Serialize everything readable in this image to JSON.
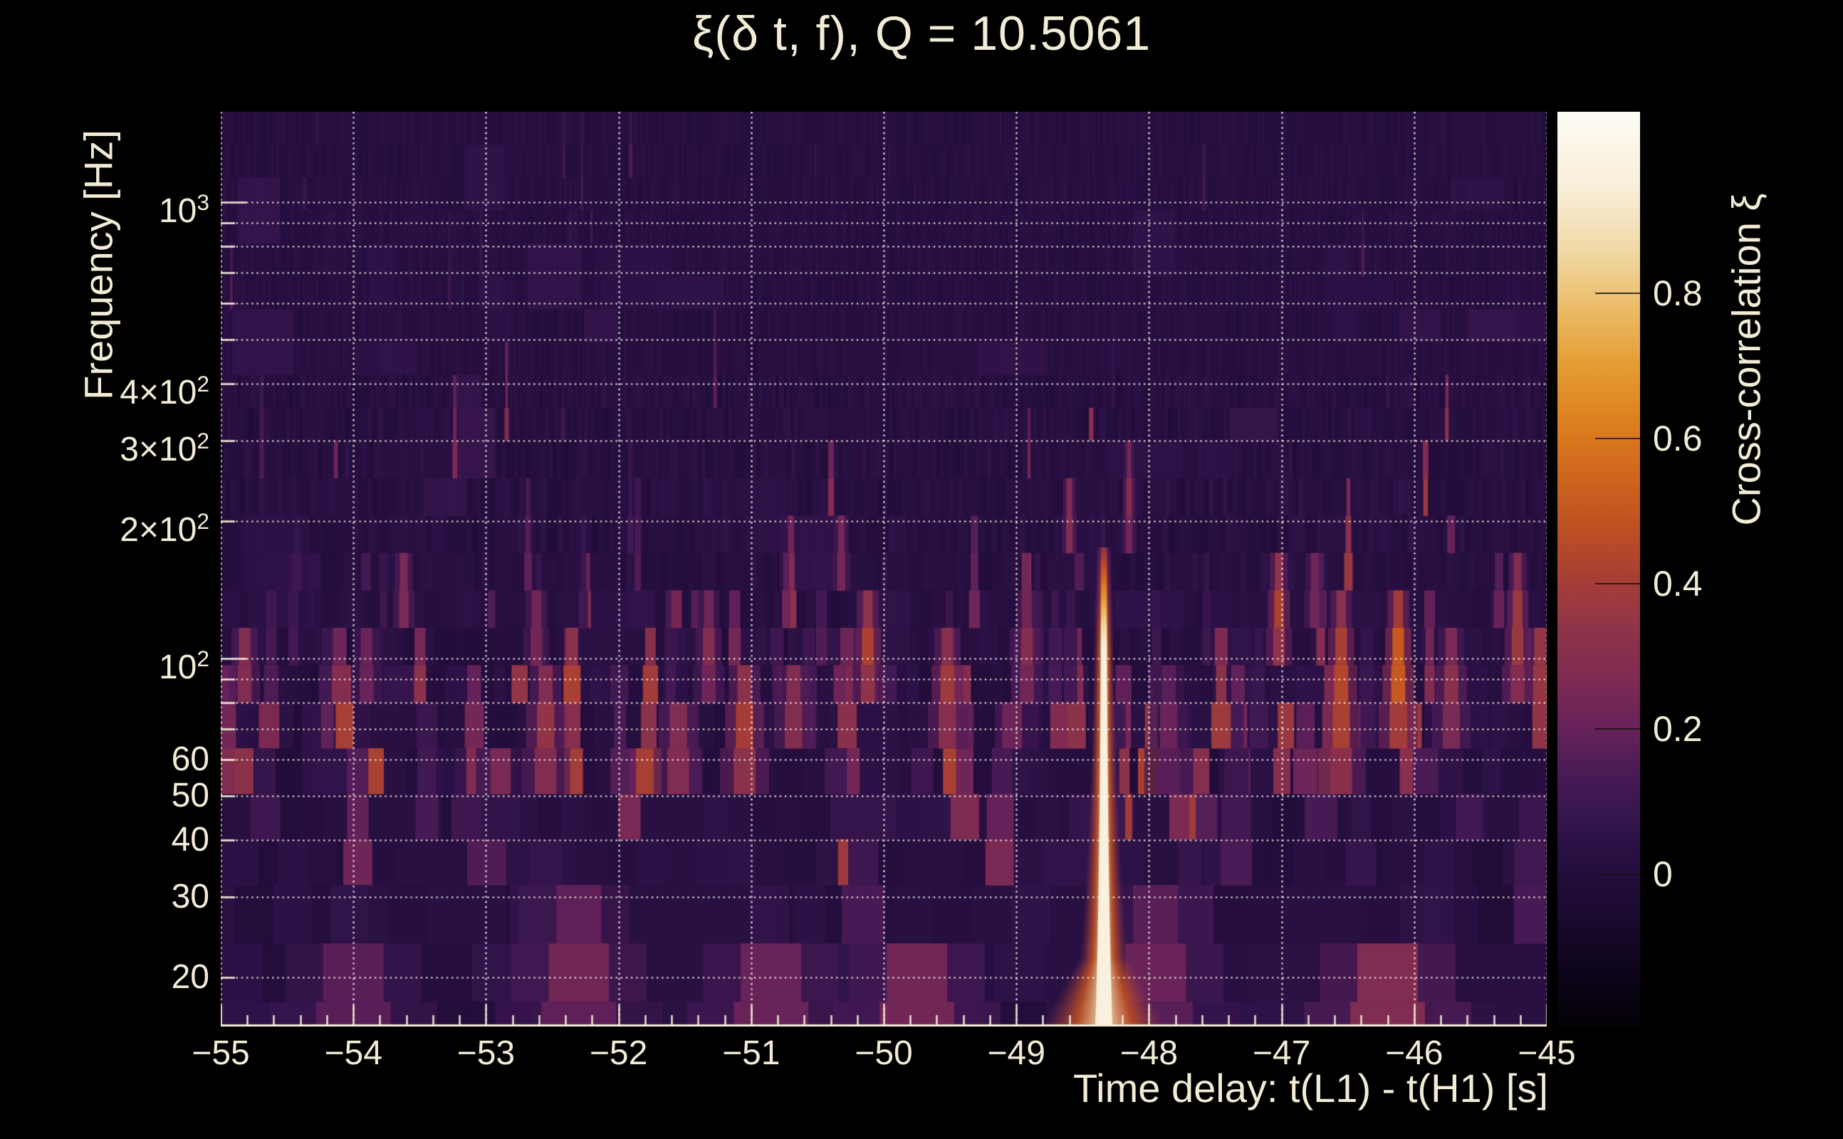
{
  "chart_data": {
    "type": "heatmap",
    "title": "ξ(δ t, f), Q = 10.5061",
    "q_value": 10.5061,
    "xlabel": "Time delay: t(L1) - t(H1) [s]",
    "ylabel": "Frequency [Hz]",
    "zlabel": "Cross-correlation ξ",
    "x_range": [
      -55,
      -45
    ],
    "x_major_ticks": [
      -55,
      -54,
      -53,
      -52,
      -51,
      -50,
      -49,
      -48,
      -47,
      -46,
      -45
    ],
    "x_tick_labels": [
      "−55",
      "−54",
      "−53",
      "−52",
      "−51",
      "−50",
      "−49",
      "−48",
      "−47",
      "−46",
      "−45"
    ],
    "x_minor_step": 0.2,
    "y_scale": "log",
    "y_range": [
      15.6,
      1578
    ],
    "y_ticks": [
      {
        "f": 1000,
        "main": "10",
        "sup": "3"
      },
      {
        "f": 400,
        "main": "4×10",
        "sup": "2"
      },
      {
        "f": 300,
        "main": "3×10",
        "sup": "2"
      },
      {
        "f": 200,
        "main": "2×10",
        "sup": "2"
      },
      {
        "f": 100,
        "main": "10",
        "sup": "2"
      },
      {
        "f": 60,
        "main": "60",
        "sup": ""
      },
      {
        "f": 50,
        "main": "50",
        "sup": ""
      },
      {
        "f": 40,
        "main": "40",
        "sup": ""
      },
      {
        "f": 30,
        "main": "30",
        "sup": ""
      },
      {
        "f": 20,
        "main": "20",
        "sup": ""
      }
    ],
    "y_gridlines": [
      20,
      30,
      40,
      50,
      60,
      70,
      80,
      90,
      100,
      200,
      300,
      400,
      500,
      600,
      700,
      800,
      900,
      1000
    ],
    "z_range": [
      -0.21,
      1.05
    ],
    "z_ticks": [
      {
        "v": 0.8,
        "label": "0.8"
      },
      {
        "v": 0.6,
        "label": "0.6"
      },
      {
        "v": 0.4,
        "label": "0.4"
      },
      {
        "v": 0.2,
        "label": "0.2"
      },
      {
        "v": 0.0,
        "label": "0"
      }
    ],
    "grid": "dotted",
    "legend_position": "right",
    "colors": {
      "background": "#000000",
      "text": "#f2ecd6",
      "axis": "#f2ecd6",
      "grid": "rgba(250,246,235,0.95)"
    },
    "palette": [
      [
        -0.21,
        "#040106"
      ],
      [
        -0.13,
        "#0e051c"
      ],
      [
        -0.05,
        "#1c0a31"
      ],
      [
        0.0,
        "#230d3c"
      ],
      [
        0.06,
        "#2f1349"
      ],
      [
        0.13,
        "#471a55"
      ],
      [
        0.2,
        "#66225a"
      ],
      [
        0.27,
        "#7f2b52"
      ],
      [
        0.34,
        "#8f3448"
      ],
      [
        0.41,
        "#a83f35"
      ],
      [
        0.48,
        "#bf5022"
      ],
      [
        0.55,
        "#d0661d"
      ],
      [
        0.62,
        "#dc7f1f"
      ],
      [
        0.7,
        "#e49c33"
      ],
      [
        0.78,
        "#ebbc67"
      ],
      [
        0.86,
        "#f1d9a6"
      ],
      [
        0.94,
        "#f8edd6"
      ],
      [
        1.05,
        "#fdfcf4"
      ]
    ],
    "main_event": {
      "t": -48.34,
      "f_min": 15.6,
      "f_max": 175,
      "xi_peak": 0.97
    },
    "features": [
      {
        "t": -46.12,
        "f_lo": 80,
        "f_hi": 118,
        "xi": 0.5
      },
      {
        "t": -46.55,
        "f_lo": 62,
        "f_hi": 122,
        "xi": 0.42
      },
      {
        "t": -47.02,
        "f_lo": 104,
        "f_hi": 148,
        "xi": 0.4
      },
      {
        "t": -49.52,
        "f_lo": 72,
        "f_hi": 108,
        "xi": 0.36
      },
      {
        "t": -51.05,
        "f_lo": 60,
        "f_hi": 96,
        "xi": 0.38
      },
      {
        "t": -50.12,
        "f_lo": 86,
        "f_hi": 120,
        "xi": 0.4
      },
      {
        "t": -50.68,
        "f_lo": 68,
        "f_hi": 92,
        "xi": 0.3
      },
      {
        "t": -52.55,
        "f_lo": 56,
        "f_hi": 86,
        "xi": 0.33
      },
      {
        "t": -45.22,
        "f_lo": 95,
        "f_hi": 150,
        "xi": 0.36
      },
      {
        "t": -45.72,
        "f_lo": 70,
        "f_hi": 115,
        "xi": 0.3
      },
      {
        "t": -53.62,
        "f_lo": 128,
        "f_hi": 168,
        "xi": 0.27
      },
      {
        "t": -54.82,
        "f_lo": 84,
        "f_hi": 108,
        "xi": 0.3
      },
      {
        "t": -51.32,
        "f_lo": 95,
        "f_hi": 132,
        "xi": 0.27
      },
      {
        "t": -48.92,
        "f_lo": 95,
        "f_hi": 135,
        "xi": 0.28
      },
      {
        "t": -50.32,
        "f_lo": 148,
        "f_hi": 185,
        "xi": 0.26
      },
      {
        "t": -46.75,
        "f_lo": 128,
        "f_hi": 160,
        "xi": 0.24
      },
      {
        "t": -45.05,
        "f_lo": 84,
        "f_hi": 106,
        "xi": 0.38
      },
      {
        "t": -51.55,
        "f_lo": 58,
        "f_hi": 76,
        "xi": 0.3
      },
      {
        "t": -48.6,
        "f_lo": 185,
        "f_hi": 225,
        "xi": 0.3
      },
      {
        "t": -48.15,
        "f_lo": 195,
        "f_hi": 260,
        "xi": 0.28
      },
      {
        "t": -47.85,
        "f_lo": 60,
        "f_hi": 95,
        "xi": 0.2
      },
      {
        "t": -53.9,
        "f_lo": 90,
        "f_hi": 110,
        "xi": 0.22
      },
      {
        "t": -52.62,
        "f_lo": 100,
        "f_hi": 125,
        "xi": 0.25
      },
      {
        "t": -52.3,
        "f_lo": 15.6,
        "f_hi": 24,
        "xi": 0.22
      },
      {
        "t": -49.75,
        "f_lo": 15.6,
        "f_hi": 22,
        "xi": 0.25
      },
      {
        "t": -54.0,
        "f_lo": 15.6,
        "f_hi": 21,
        "xi": 0.18
      },
      {
        "t": -50.85,
        "f_lo": 15.6,
        "f_hi": 23,
        "xi": 0.22
      },
      {
        "t": -47.95,
        "f_lo": 15.6,
        "f_hi": 26,
        "xi": 0.2
      },
      {
        "t": -46.2,
        "f_lo": 15.6,
        "f_hi": 22,
        "xi": 0.3
      }
    ],
    "noise": {
      "seed": 1337,
      "base": 0.022,
      "sigma": 0.05,
      "streaklets": 150,
      "soft_columns": 60
    }
  }
}
